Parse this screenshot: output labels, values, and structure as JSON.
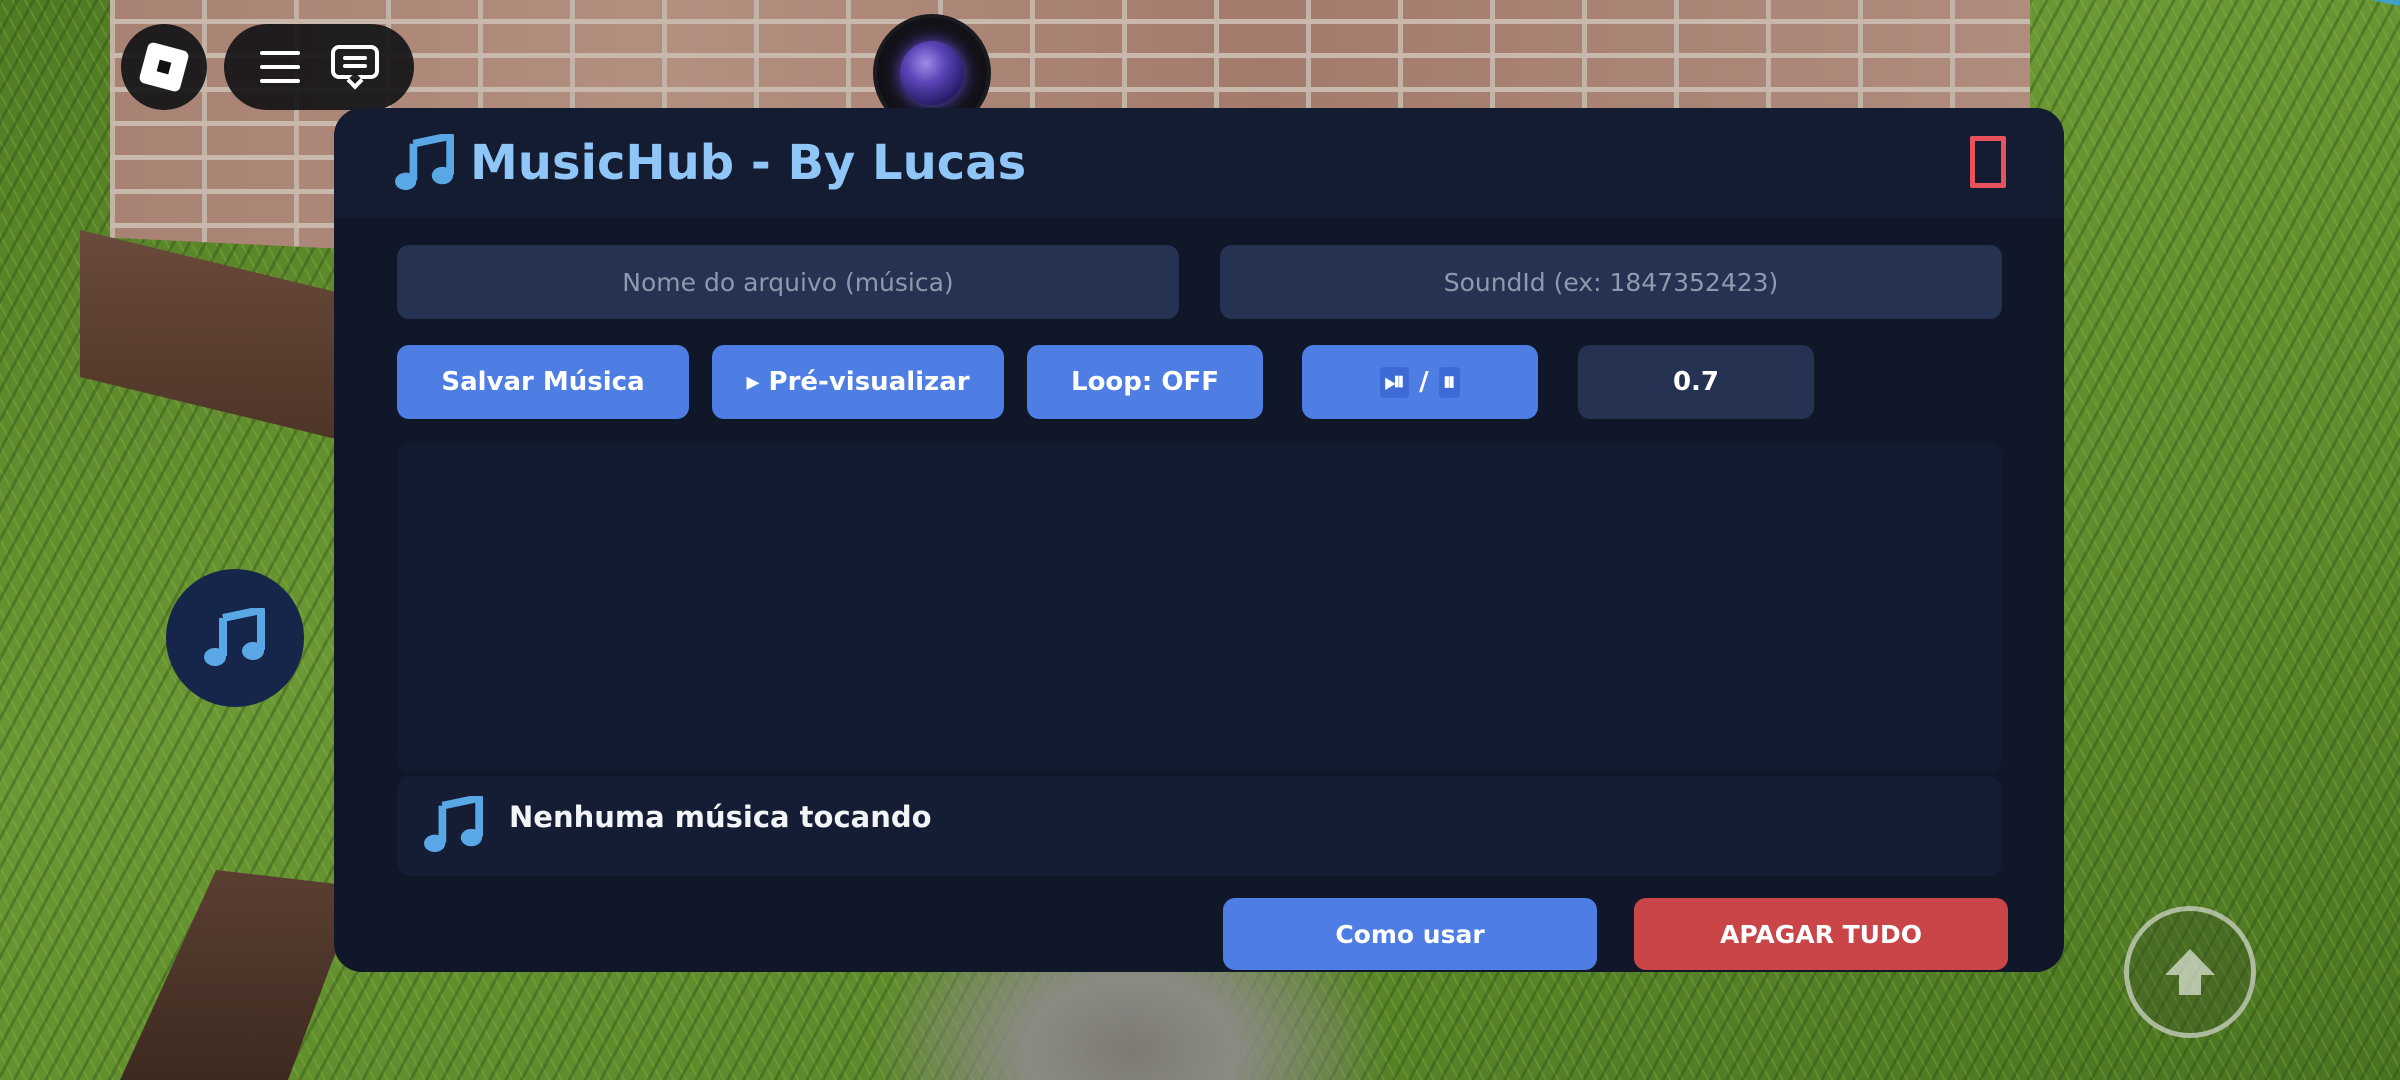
{
  "window": {
    "title": "MusicHub - By Lucas",
    "title_icon": "music-note-icon",
    "close_icon": "close-icon"
  },
  "inputs": {
    "name_placeholder": "Nome do arquivo (música)",
    "name_value": "",
    "soundid_placeholder": "SoundId (ex: 1847352423)",
    "soundid_value": ""
  },
  "controls": {
    "save_label": "Salvar Música",
    "preview_label": "▸ Pré-visualizar",
    "loop_label": "Loop: OFF",
    "playpause_a": "⏯",
    "playpause_sep": "/",
    "playpause_b": "⏸",
    "volume_value": "0.7"
  },
  "music_list": {
    "items": []
  },
  "now_playing": {
    "icon": "music-note-icon",
    "text": "Nenhuma música tocando"
  },
  "footer": {
    "help_label": "Como usar",
    "clear_label": "APAGAR TUDO"
  },
  "colors": {
    "panel_bg": "#101728",
    "header_bg": "#141c31",
    "accent_blue": "#4e7de3",
    "danger_red": "#c94548",
    "title_blue": "#8fc6f7",
    "field_bg": "#253252"
  }
}
